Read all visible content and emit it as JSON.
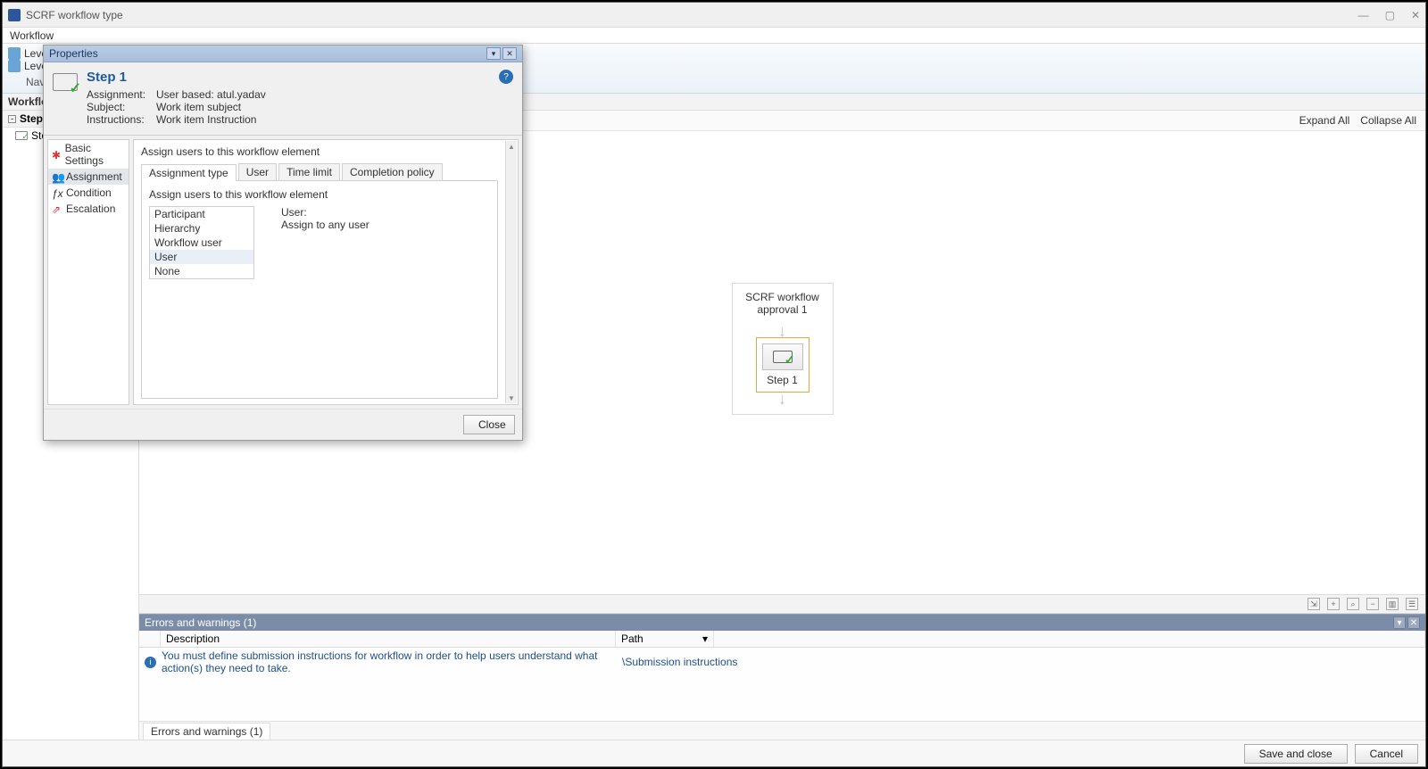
{
  "titlebar": {
    "title": "SCRF workflow type"
  },
  "ribbon": {
    "tab_workflow": "Workflow"
  },
  "toolbar": {
    "level1": "Level",
    "level2": "Level",
    "navigate": "Navig"
  },
  "secondary": {
    "workflow": "Workflow"
  },
  "left": {
    "steps_header": "Steps",
    "step1": "Step"
  },
  "canvas_links": {
    "expand": "Expand All",
    "collapse": "Collapse All"
  },
  "workflow_node": {
    "title": "SCRF workflow approval 1",
    "step_label": "Step 1"
  },
  "errors": {
    "title": "Errors and warnings (1)",
    "col_desc": "Description",
    "col_path": "Path",
    "row_desc": "You must define submission instructions for workflow  in order to help users understand what action(s) they need to take.",
    "row_path": "\\Submission instructions",
    "tab": "Errors and warnings (1)"
  },
  "footer": {
    "save_close": "Save and close",
    "cancel": "Cancel"
  },
  "dialog": {
    "title": "Properties",
    "step_title": "Step 1",
    "info": {
      "assignment_k": "Assignment:",
      "assignment_v": "User based: atul.yadav",
      "subject_k": "Subject:",
      "subject_v": "Work item subject",
      "instructions_k": "Instructions:",
      "instructions_v": "Work item Instruction"
    },
    "side": {
      "basic": "Basic Settings",
      "assignment": "Assignment",
      "condition": "Condition",
      "escalation": "Escalation"
    },
    "content_heading": "Assign users to this workflow element",
    "tabs": {
      "assignment_type": "Assignment type",
      "user": "User",
      "time_limit": "Time limit",
      "completion_policy": "Completion policy"
    },
    "panel_heading": "Assign users to this workflow element",
    "list": {
      "participant": "Participant",
      "hierarchy": "Hierarchy",
      "workflow_user": "Workflow user",
      "user": "User",
      "none": "None"
    },
    "right_label": "User:",
    "right_value": "Assign to any user",
    "close": "Close"
  }
}
